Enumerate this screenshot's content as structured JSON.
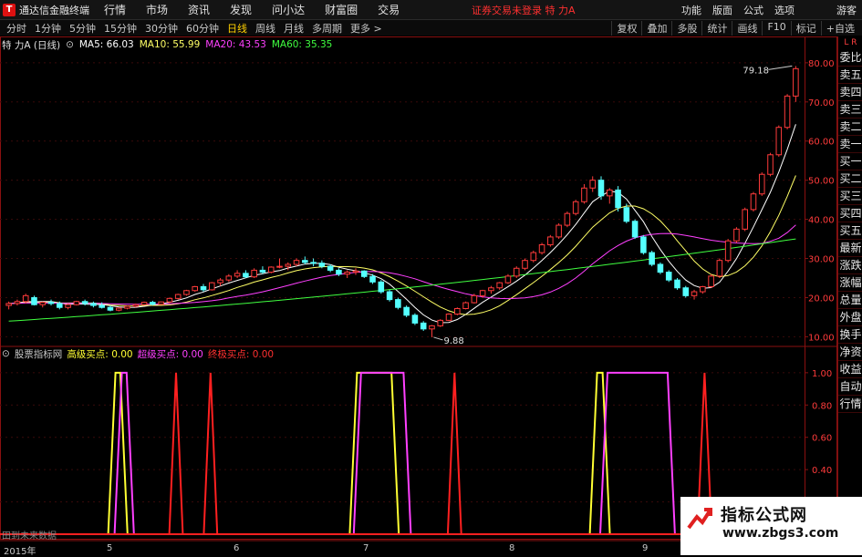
{
  "menubar": {
    "app_title": "通达信金融终端",
    "items": [
      "行情",
      "市场",
      "资讯",
      "发现",
      "问小达",
      "财富圈",
      "交易"
    ],
    "login_status": "证券交易未登录 特 力A",
    "right_items": [
      "功能",
      "版面",
      "公式",
      "选项"
    ],
    "guest": "游客"
  },
  "toolbar": {
    "periods": [
      "分时",
      "1分钟",
      "5分钟",
      "15分钟",
      "30分钟",
      "60分钟",
      "日线",
      "周线",
      "月线",
      "多周期",
      "更多 >"
    ],
    "active": "日线",
    "right_items": [
      "复权",
      "叠加",
      "多股",
      "统计",
      "画线",
      "F10",
      "标记",
      "+自选"
    ]
  },
  "main_legend": {
    "stock": "特 力A (日线)",
    "ma5": "MA5: 66.03",
    "ma10": "MA10: 55.99",
    "ma20": "MA20: 43.53",
    "ma60": "MA60: 35.35"
  },
  "indicator_legend": {
    "name": "股票指标网",
    "a": "高级买点: 0.00",
    "b": "超级买点: 0.00",
    "c": "终极买点: 0.00"
  },
  "price_axis": [
    "80.00",
    "70.00",
    "60.00",
    "50.00",
    "40.00",
    "30.00",
    "20.00",
    "10.00"
  ],
  "indicator_axis": [
    "1.00",
    "0.80",
    "0.60",
    "0.40",
    "0.20"
  ],
  "annotations": {
    "high": "79.18",
    "low": "9.88"
  },
  "side_panel": {
    "top": "L R",
    "items": [
      "委比",
      "卖五",
      "卖四",
      "卖三",
      "卖二",
      "卖一",
      "买一",
      "买二",
      "买三",
      "买四",
      "买五",
      "最新",
      "涨跌",
      "涨幅",
      "总量",
      "外盘",
      "换手",
      "净资",
      "收益",
      "自动",
      "行情"
    ]
  },
  "bottom": {
    "note": "田到未来数据",
    "year": "2015年",
    "months": [
      "5",
      "6",
      "7",
      "8",
      "9"
    ]
  },
  "watermark": {
    "title": "指标公式网",
    "url": "www.zbgs3.com"
  },
  "colors": {
    "up": "#ff3b3b",
    "down": "#54ffff",
    "ma5": "#ffffff",
    "ma10": "#ffff66",
    "ma20": "#ff40ff",
    "ma60": "#40ff40",
    "signal_yellow": "#ffff33",
    "signal_magenta": "#ff40ff",
    "signal_red": "#ff2020",
    "axis": "#8a1010"
  },
  "chart_data": {
    "type": "candlestick",
    "price_range": [
      8,
      83
    ],
    "candles": [
      [
        18,
        19,
        17,
        18.5
      ],
      [
        18.5,
        19.5,
        18,
        19
      ],
      [
        19,
        21,
        18.5,
        20.5
      ],
      [
        20,
        20.5,
        18,
        18.2
      ],
      [
        18.2,
        19,
        17.5,
        18.8
      ],
      [
        18.8,
        19.5,
        18,
        18.5
      ],
      [
        18.5,
        19,
        17,
        17.5
      ],
      [
        17.5,
        18.5,
        17,
        18.2
      ],
      [
        18.2,
        19.2,
        18,
        19
      ],
      [
        19,
        19.5,
        18,
        18.5
      ],
      [
        18.5,
        19,
        17.5,
        18
      ],
      [
        18,
        18.8,
        17.2,
        17.5
      ],
      [
        17.5,
        18,
        16.5,
        16.8
      ],
      [
        16.8,
        17.5,
        16.5,
        17.3
      ],
      [
        17.3,
        18,
        17,
        17.8
      ],
      [
        17.8,
        18.5,
        17.5,
        18.2
      ],
      [
        18.2,
        19,
        18,
        18.8
      ],
      [
        18.8,
        19.2,
        18,
        18.3
      ],
      [
        18.3,
        19,
        18.2,
        18.9
      ],
      [
        18.9,
        20,
        18.5,
        19.8
      ],
      [
        19.8,
        21,
        19.5,
        20.8
      ],
      [
        20.8,
        22,
        20.5,
        21.8
      ],
      [
        21.8,
        23,
        21.5,
        22.8
      ],
      [
        22.8,
        23.5,
        21.5,
        22
      ],
      [
        22,
        24,
        21.8,
        23.8
      ],
      [
        23.8,
        25,
        23,
        24.5
      ],
      [
        24.5,
        26,
        24,
        25.5
      ],
      [
        25.5,
        27,
        25,
        26.2
      ],
      [
        26.2,
        27,
        25,
        25.3
      ],
      [
        25.3,
        27.5,
        25,
        27
      ],
      [
        27,
        28,
        26,
        26.5
      ],
      [
        26.5,
        28,
        26.2,
        27.8
      ],
      [
        27.8,
        30,
        27.5,
        28
      ],
      [
        28,
        29,
        27,
        28.5
      ],
      [
        28.5,
        30,
        28,
        29.5
      ],
      [
        29.5,
        30.5,
        28.5,
        29
      ],
      [
        29,
        30,
        28,
        28.8
      ],
      [
        28.8,
        29.5,
        27.5,
        28
      ],
      [
        28,
        28.5,
        26.5,
        27
      ],
      [
        27,
        27.5,
        25.5,
        26
      ],
      [
        26,
        27,
        25,
        26.5
      ],
      [
        26.5,
        27.5,
        25.8,
        26.8
      ],
      [
        26.8,
        27,
        25,
        25.4
      ],
      [
        25.4,
        26,
        23.5,
        24
      ],
      [
        24,
        24.5,
        21,
        21.5
      ],
      [
        21.5,
        22,
        19,
        19.5
      ],
      [
        19.5,
        20,
        17,
        17.5
      ],
      [
        17.5,
        18,
        15,
        15.5
      ],
      [
        15.5,
        16,
        13,
        13.5
      ],
      [
        13.5,
        14,
        11.5,
        12
      ],
      [
        12,
        13,
        9.88,
        12.8
      ],
      [
        12.8,
        14.5,
        12.5,
        14.2
      ],
      [
        14.2,
        16,
        14,
        15.8
      ],
      [
        15.8,
        17.5,
        15.5,
        17.2
      ],
      [
        17.2,
        19,
        17,
        18.7
      ],
      [
        18.7,
        21,
        18.5,
        20.5
      ],
      [
        20.5,
        22,
        20,
        21.8
      ],
      [
        21.8,
        23,
        21,
        22.5
      ],
      [
        22.5,
        24,
        22,
        23.8
      ],
      [
        23.8,
        26,
        23.5,
        25.5
      ],
      [
        25.5,
        28,
        25,
        27.5
      ],
      [
        27.5,
        30,
        27,
        29.5
      ],
      [
        29.5,
        32,
        29,
        31.5
      ],
      [
        31.5,
        34,
        31,
        33.5
      ],
      [
        33.5,
        36,
        33,
        35.5
      ],
      [
        35.5,
        39,
        35,
        38.5
      ],
      [
        38.5,
        42,
        38,
        41.5
      ],
      [
        41.5,
        45,
        41,
        44.5
      ],
      [
        44.5,
        49,
        44,
        48
      ],
      [
        48,
        51,
        47,
        50
      ],
      [
        50,
        51,
        45,
        46
      ],
      [
        46,
        48,
        44,
        47.5
      ],
      [
        47.5,
        48.5,
        42,
        43
      ],
      [
        43,
        44,
        39,
        39.5
      ],
      [
        39.5,
        40,
        35,
        35.5
      ],
      [
        35.5,
        36,
        31,
        31.5
      ],
      [
        31.5,
        32,
        28,
        28.5
      ],
      [
        28.5,
        29,
        26,
        26.5
      ],
      [
        26.5,
        27,
        24,
        24.5
      ],
      [
        24.5,
        25,
        22,
        22.5
      ],
      [
        22.5,
        23,
        20,
        20.5
      ],
      [
        20.5,
        22,
        19.5,
        21.5
      ],
      [
        21.5,
        23,
        21,
        22.8
      ],
      [
        22.8,
        26,
        22.5,
        25.5
      ],
      [
        25.5,
        30,
        25,
        29.5
      ],
      [
        29.5,
        35,
        29,
        34.5
      ],
      [
        34.5,
        38,
        34,
        37.5
      ],
      [
        37.5,
        43,
        37,
        42.5
      ],
      [
        42.5,
        47,
        42,
        46.5
      ],
      [
        46.5,
        52,
        46,
        51.5
      ],
      [
        51.5,
        57,
        51,
        56.5
      ],
      [
        56.5,
        64,
        56,
        63.5
      ],
      [
        63.5,
        72,
        63,
        71.5
      ],
      [
        71.5,
        79.18,
        70,
        78.5
      ]
    ],
    "ma_periods": [
      5,
      10,
      20,
      60
    ],
    "indicator_range": [
      0,
      1.05
    ],
    "signals": [
      {
        "name": "高级买点",
        "pulses": [
          [
            0.137,
            0.152
          ],
          [
            0.438,
            0.49
          ],
          [
            0.737,
            0.753
          ]
        ]
      },
      {
        "name": "超级买点",
        "pulses": [
          [
            0.145,
            0.16
          ],
          [
            0.443,
            0.505
          ],
          [
            0.75,
            0.834
          ]
        ]
      },
      {
        "name": "终极买点",
        "pulses": [
          [
            0.212,
            0.222
          ],
          [
            0.255,
            0.265
          ],
          [
            0.559,
            0.569
          ],
          [
            0.87,
            0.881
          ]
        ]
      }
    ]
  }
}
